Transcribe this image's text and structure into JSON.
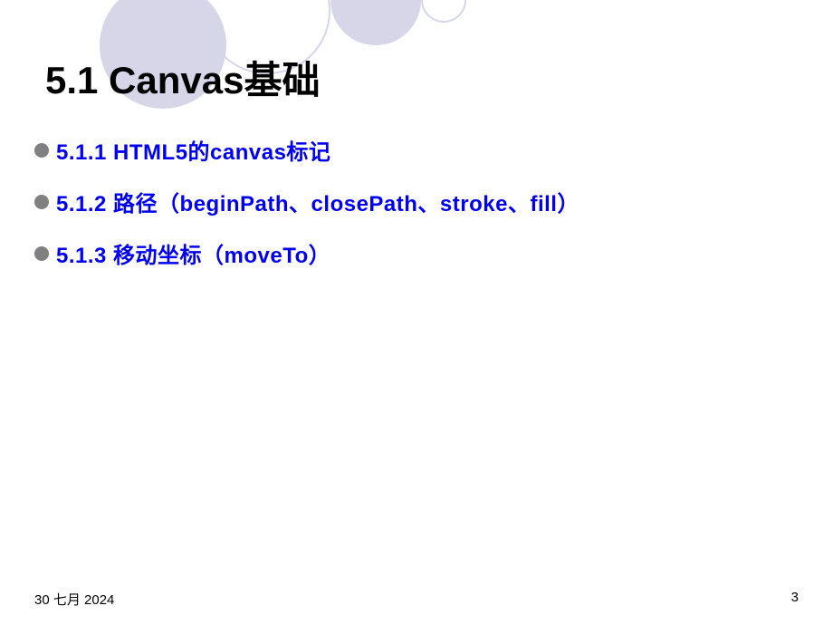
{
  "title": "5.1  Canvas基础",
  "bullets": [
    "5.1.1  HTML5的canvas标记",
    "5.1.2  路径（beginPath、closePath、stroke、fill）",
    "5.1.3  移动坐标（moveTo）"
  ],
  "footer": {
    "date": "30 七月 2024",
    "page": "3"
  }
}
